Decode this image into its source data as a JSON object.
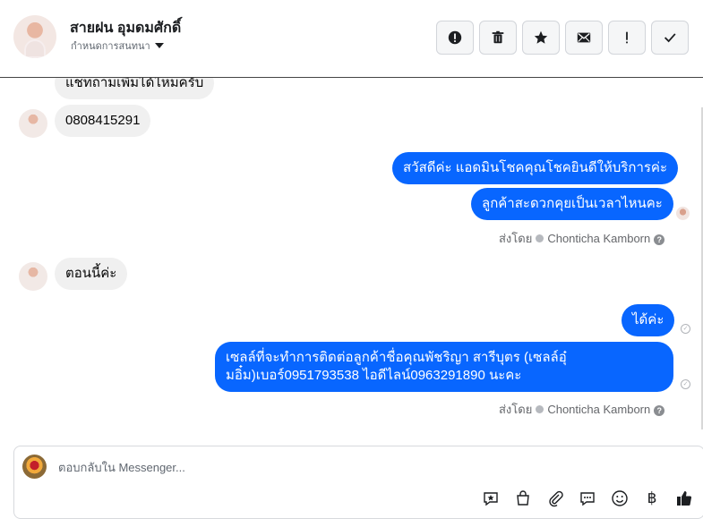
{
  "header": {
    "contact_name": "สายฝน อุมดมศักดิ์",
    "subtitle": "กำหนดการสนทนา",
    "actions": [
      {
        "name": "report",
        "icon": "alert-circle-icon"
      },
      {
        "name": "delete",
        "icon": "trash-icon"
      },
      {
        "name": "star",
        "icon": "star-icon"
      },
      {
        "name": "mark-unread",
        "icon": "envelope-icon"
      },
      {
        "name": "important",
        "icon": "exclamation-icon"
      },
      {
        "name": "done",
        "icon": "check-icon"
      }
    ]
  },
  "messages": [
    {
      "direction": "in",
      "text": "แชทถามเพิ่มได้ไหมครับ"
    },
    {
      "direction": "in",
      "text": "0808415291"
    },
    {
      "direction": "out",
      "text": "สวัสดีค่ะ แอดมินโชคคุณโชคยินดีให้บริการค่ะ"
    },
    {
      "direction": "out",
      "text": "ลูกค้าสะดวกคุยเป็นเวลาไหนคะ"
    },
    {
      "direction": "in",
      "text": "ตอนนี้ค่ะ"
    },
    {
      "direction": "out",
      "text": "ได้ค่ะ"
    },
    {
      "direction": "out",
      "text": "เซลล์ที่จะทำการติดต่อลูกค้าชื่อคุณพัชริญา สารีบุตร (เซลล์อุ๋มอิ๋ม)เบอร์0951793538 ไอดีไลน์0963291890 นะคะ"
    }
  ],
  "sent_by": {
    "label": "ส่งโดย",
    "agent": "Chonticha Kamborn"
  },
  "composer": {
    "placeholder": "ตอบกลับใน Messenger...",
    "tools": [
      "saved-reply-icon",
      "shopping-bag-icon",
      "attachment-icon",
      "chat-bubbles-icon",
      "emoji-icon",
      "baht-icon",
      "thumbs-up-icon"
    ],
    "baht_symbol": "฿"
  },
  "colors": {
    "outgoing_bubble": "#0866ff",
    "incoming_bubble": "#f0f0f0"
  }
}
